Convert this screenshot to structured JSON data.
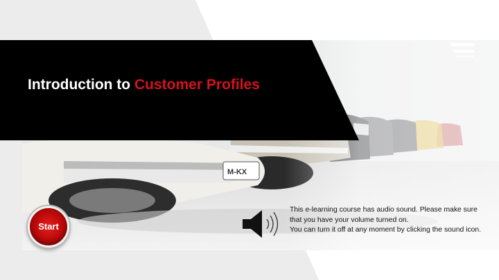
{
  "slide": {
    "title_prefix": "Introduction to ",
    "title_highlight": "Customer Profiles",
    "accent_color": "#d4121e",
    "banner_color": "#000000"
  },
  "start_button": {
    "label": "Start",
    "icon": "start-button-icon"
  },
  "sound": {
    "icon": "speaker-icon"
  },
  "info_text": {
    "line1": "This e-learning course has audio sound. Please make sure that you have your volume turned on.",
    "line2": "You can turn it off at any moment by clicking the sound icon."
  }
}
